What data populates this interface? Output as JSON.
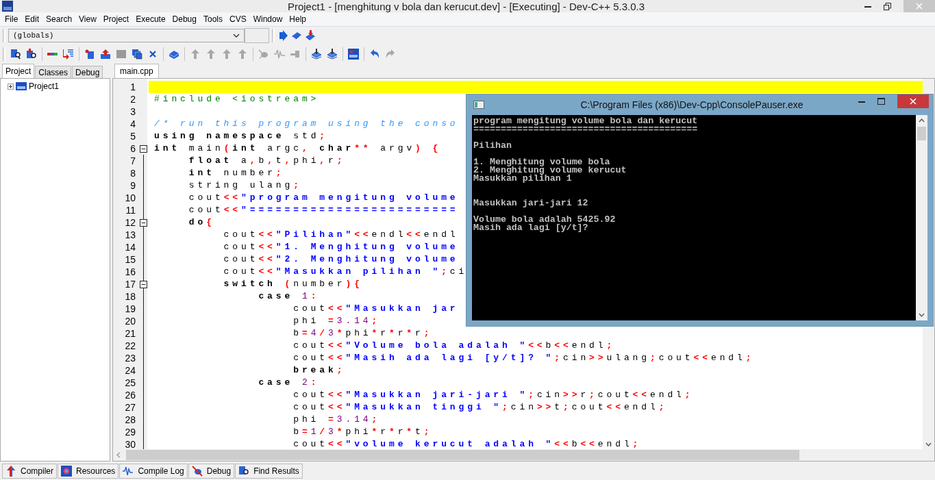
{
  "window": {
    "title": "Project1 - [menghitung v bola dan kerucut.dev] - [Executing] - Dev-C++ 5.3.0.3"
  },
  "menu": [
    "File",
    "Edit",
    "Search",
    "View",
    "Project",
    "Execute",
    "Debug",
    "Tools",
    "CVS",
    "Window",
    "Help"
  ],
  "toolbar": {
    "scope_dropdown": "(globals)"
  },
  "left_panel": {
    "tabs": [
      {
        "label": "Project",
        "selected": true
      },
      {
        "label": "Classes",
        "selected": false
      },
      {
        "label": "Debug",
        "selected": false
      }
    ],
    "tree": [
      {
        "label": "Project1",
        "expanded": false
      }
    ]
  },
  "editor": {
    "tabs": [
      {
        "label": "main.cpp",
        "selected": true
      }
    ],
    "lines": [
      {
        "number": "1",
        "fold": false,
        "current": true
      },
      {
        "number": "2",
        "fold": false,
        "current": false,
        "tokens": [
          {
            "kind": "pre",
            "text": "#include <iostream>"
          }
        ]
      },
      {
        "number": "3",
        "fold": false,
        "current": false
      },
      {
        "number": "4",
        "fold": false,
        "current": false,
        "tokens": [
          {
            "kind": "cmt",
            "text": "/* run this program using the conso"
          }
        ]
      },
      {
        "number": "5",
        "fold": false,
        "current": false,
        "tokens": [
          {
            "kind": "kw",
            "text": "using namespace"
          },
          {
            "kind": "id",
            "text": " std"
          },
          {
            "kind": "op",
            "text": ";"
          }
        ]
      },
      {
        "number": "6",
        "fold": true,
        "current": false,
        "tokens": [
          {
            "kind": "kw",
            "text": "int"
          },
          {
            "kind": "id",
            "text": " main"
          },
          {
            "kind": "op",
            "text": "("
          },
          {
            "kind": "kw",
            "text": "int"
          },
          {
            "kind": "id",
            "text": " argc"
          },
          {
            "kind": "op",
            "text": ","
          },
          {
            "kind": "kw",
            "text": " char"
          },
          {
            "kind": "op",
            "text": "**"
          },
          {
            "kind": "id",
            "text": " argv"
          },
          {
            "kind": "op",
            "text": ") {"
          }
        ]
      },
      {
        "number": "7",
        "fold": false,
        "current": false,
        "tokens": [
          {
            "kind": "kw",
            "text": "    float"
          },
          {
            "kind": "id",
            "text": " a"
          },
          {
            "kind": "op",
            "text": ","
          },
          {
            "kind": "id",
            "text": "b"
          },
          {
            "kind": "op",
            "text": ","
          },
          {
            "kind": "id",
            "text": "t"
          },
          {
            "kind": "op",
            "text": ","
          },
          {
            "kind": "id",
            "text": "phi"
          },
          {
            "kind": "op",
            "text": ","
          },
          {
            "kind": "id",
            "text": "r"
          },
          {
            "kind": "op",
            "text": ";"
          }
        ]
      },
      {
        "number": "8",
        "fold": false,
        "current": false,
        "tokens": [
          {
            "kind": "kw",
            "text": "    int"
          },
          {
            "kind": "id",
            "text": " number"
          },
          {
            "kind": "op",
            "text": ";"
          }
        ]
      },
      {
        "number": "9",
        "fold": false,
        "current": false,
        "tokens": [
          {
            "kind": "id",
            "text": "    string ulang"
          },
          {
            "kind": "op",
            "text": ";"
          }
        ]
      },
      {
        "number": "10",
        "fold": false,
        "current": false,
        "tokens": [
          {
            "kind": "id",
            "text": "    cout"
          },
          {
            "kind": "op",
            "text": "<<"
          },
          {
            "kind": "str",
            "text": "\"program mengitung volume"
          }
        ]
      },
      {
        "number": "11",
        "fold": false,
        "current": false,
        "tokens": [
          {
            "kind": "id",
            "text": "    cout"
          },
          {
            "kind": "op",
            "text": "<<"
          },
          {
            "kind": "str",
            "text": "\"========================"
          }
        ]
      },
      {
        "number": "12",
        "fold": true,
        "current": false,
        "tokens": [
          {
            "kind": "kw",
            "text": "    do"
          },
          {
            "kind": "op",
            "text": "{"
          }
        ]
      },
      {
        "number": "13",
        "fold": false,
        "current": false,
        "tokens": [
          {
            "kind": "id",
            "text": "        cout"
          },
          {
            "kind": "op",
            "text": "<<"
          },
          {
            "kind": "str",
            "text": "\"Pilihan\""
          },
          {
            "kind": "op",
            "text": "<<"
          },
          {
            "kind": "id",
            "text": "endl"
          },
          {
            "kind": "op",
            "text": "<<"
          },
          {
            "kind": "id",
            "text": "endl"
          }
        ]
      },
      {
        "number": "14",
        "fold": false,
        "current": false,
        "tokens": [
          {
            "kind": "id",
            "text": "        cout"
          },
          {
            "kind": "op",
            "text": "<<"
          },
          {
            "kind": "str",
            "text": "\"1. Menghitung volume"
          }
        ]
      },
      {
        "number": "15",
        "fold": false,
        "current": false,
        "tokens": [
          {
            "kind": "id",
            "text": "        cout"
          },
          {
            "kind": "op",
            "text": "<<"
          },
          {
            "kind": "str",
            "text": "\"2. Menghitung volume"
          }
        ]
      },
      {
        "number": "16",
        "fold": false,
        "current": false,
        "tokens": [
          {
            "kind": "id",
            "text": "        cout"
          },
          {
            "kind": "op",
            "text": "<<"
          },
          {
            "kind": "str",
            "text": "\"Masukkan pilihan \""
          },
          {
            "kind": "op",
            "text": ";"
          },
          {
            "kind": "id",
            "text": "ci"
          }
        ]
      },
      {
        "number": "17",
        "fold": true,
        "current": false,
        "tokens": [
          {
            "kind": "kw",
            "text": "        switch"
          },
          {
            "kind": "op",
            "text": " ("
          },
          {
            "kind": "id",
            "text": "number"
          },
          {
            "kind": "op",
            "text": "){"
          }
        ]
      },
      {
        "number": "18",
        "fold": false,
        "current": false,
        "tokens": [
          {
            "kind": "kw",
            "text": "            case"
          },
          {
            "kind": "num",
            "text": " 1"
          },
          {
            "kind": "op",
            "text": ":"
          }
        ]
      },
      {
        "number": "19",
        "fold": false,
        "current": false,
        "tokens": [
          {
            "kind": "id",
            "text": "                cout"
          },
          {
            "kind": "op",
            "text": "<<"
          },
          {
            "kind": "str",
            "text": "\"Masukkan jar"
          }
        ]
      },
      {
        "number": "20",
        "fold": false,
        "current": false,
        "tokens": [
          {
            "kind": "id",
            "text": "                phi "
          },
          {
            "kind": "op",
            "text": "="
          },
          {
            "kind": "num",
            "text": "3.14"
          },
          {
            "kind": "op",
            "text": ";"
          }
        ]
      },
      {
        "number": "21",
        "fold": false,
        "current": false,
        "tokens": [
          {
            "kind": "id",
            "text": "                b"
          },
          {
            "kind": "op",
            "text": "="
          },
          {
            "kind": "num",
            "text": "4"
          },
          {
            "kind": "op",
            "text": "/"
          },
          {
            "kind": "num",
            "text": "3"
          },
          {
            "kind": "op",
            "text": "*"
          },
          {
            "kind": "id",
            "text": "phi"
          },
          {
            "kind": "op",
            "text": "*"
          },
          {
            "kind": "id",
            "text": "r"
          },
          {
            "kind": "op",
            "text": "*"
          },
          {
            "kind": "id",
            "text": "r"
          },
          {
            "kind": "op",
            "text": "*"
          },
          {
            "kind": "id",
            "text": "r"
          },
          {
            "kind": "op",
            "text": ";"
          }
        ]
      },
      {
        "number": "22",
        "fold": false,
        "current": false,
        "tokens": [
          {
            "kind": "id",
            "text": "                cout"
          },
          {
            "kind": "op",
            "text": "<<"
          },
          {
            "kind": "str",
            "text": "\"Volume bola adalah \""
          },
          {
            "kind": "op",
            "text": "<<"
          },
          {
            "kind": "id",
            "text": "b"
          },
          {
            "kind": "op",
            "text": "<<"
          },
          {
            "kind": "id",
            "text": "endl"
          },
          {
            "kind": "op",
            "text": ";"
          }
        ]
      },
      {
        "number": "23",
        "fold": false,
        "current": false,
        "tokens": [
          {
            "kind": "id",
            "text": "                cout"
          },
          {
            "kind": "op",
            "text": "<<"
          },
          {
            "kind": "str",
            "text": "\"Masih ada lagi [y/t]? \""
          },
          {
            "kind": "op",
            "text": ";"
          },
          {
            "kind": "id",
            "text": "cin"
          },
          {
            "kind": "op",
            "text": ">>"
          },
          {
            "kind": "id",
            "text": "ulang"
          },
          {
            "kind": "op",
            "text": ";"
          },
          {
            "kind": "id",
            "text": "cout"
          },
          {
            "kind": "op",
            "text": "<<"
          },
          {
            "kind": "id",
            "text": "endl"
          },
          {
            "kind": "op",
            "text": ";"
          }
        ]
      },
      {
        "number": "24",
        "fold": false,
        "current": false,
        "tokens": [
          {
            "kind": "kw",
            "text": "                break"
          },
          {
            "kind": "op",
            "text": ";"
          }
        ]
      },
      {
        "number": "25",
        "fold": false,
        "current": false,
        "tokens": [
          {
            "kind": "kw",
            "text": "            case"
          },
          {
            "kind": "num",
            "text": " 2"
          },
          {
            "kind": "op",
            "text": ":"
          }
        ]
      },
      {
        "number": "26",
        "fold": false,
        "current": false,
        "tokens": [
          {
            "kind": "id",
            "text": "                cout"
          },
          {
            "kind": "op",
            "text": "<<"
          },
          {
            "kind": "str",
            "text": "\"Masukkan jari-jari \""
          },
          {
            "kind": "op",
            "text": ";"
          },
          {
            "kind": "id",
            "text": "cin"
          },
          {
            "kind": "op",
            "text": ">>"
          },
          {
            "kind": "id",
            "text": "r"
          },
          {
            "kind": "op",
            "text": ";"
          },
          {
            "kind": "id",
            "text": "cout"
          },
          {
            "kind": "op",
            "text": "<<"
          },
          {
            "kind": "id",
            "text": "endl"
          },
          {
            "kind": "op",
            "text": ";"
          }
        ]
      },
      {
        "number": "27",
        "fold": false,
        "current": false,
        "tokens": [
          {
            "kind": "id",
            "text": "                cout"
          },
          {
            "kind": "op",
            "text": "<<"
          },
          {
            "kind": "str",
            "text": "\"Masukkan tinggi \""
          },
          {
            "kind": "op",
            "text": ";"
          },
          {
            "kind": "id",
            "text": "cin"
          },
          {
            "kind": "op",
            "text": ">>"
          },
          {
            "kind": "id",
            "text": "t"
          },
          {
            "kind": "op",
            "text": ";"
          },
          {
            "kind": "id",
            "text": "cout"
          },
          {
            "kind": "op",
            "text": "<<"
          },
          {
            "kind": "id",
            "text": "endl"
          },
          {
            "kind": "op",
            "text": ";"
          }
        ]
      },
      {
        "number": "28",
        "fold": false,
        "current": false,
        "tokens": [
          {
            "kind": "id",
            "text": "                phi "
          },
          {
            "kind": "op",
            "text": "="
          },
          {
            "kind": "num",
            "text": "3.14"
          },
          {
            "kind": "op",
            "text": ";"
          }
        ]
      },
      {
        "number": "29",
        "fold": false,
        "current": false,
        "tokens": [
          {
            "kind": "id",
            "text": "                b"
          },
          {
            "kind": "op",
            "text": "="
          },
          {
            "kind": "num",
            "text": "1"
          },
          {
            "kind": "op",
            "text": "/"
          },
          {
            "kind": "num",
            "text": "3"
          },
          {
            "kind": "op",
            "text": "*"
          },
          {
            "kind": "id",
            "text": "phi"
          },
          {
            "kind": "op",
            "text": "*"
          },
          {
            "kind": "id",
            "text": "r"
          },
          {
            "kind": "op",
            "text": "*"
          },
          {
            "kind": "id",
            "text": "r"
          },
          {
            "kind": "op",
            "text": "*"
          },
          {
            "kind": "id",
            "text": "t"
          },
          {
            "kind": "op",
            "text": ";"
          }
        ]
      },
      {
        "number": "30",
        "fold": false,
        "current": false,
        "tokens": [
          {
            "kind": "id",
            "text": "                cout"
          },
          {
            "kind": "op",
            "text": "<<"
          },
          {
            "kind": "str",
            "text": "\"volume kerucut adalah \""
          },
          {
            "kind": "op",
            "text": "<<"
          },
          {
            "kind": "id",
            "text": "b"
          },
          {
            "kind": "op",
            "text": "<<"
          },
          {
            "kind": "id",
            "text": "endl"
          },
          {
            "kind": "op",
            "text": ";"
          }
        ]
      }
    ]
  },
  "console": {
    "title": "C:\\Program Files (x86)\\Dev-Cpp\\ConsolePauser.exe",
    "lines": [
      {
        "kind": "text",
        "text": "program mengitung volume bola dan kerucut"
      },
      {
        "kind": "text",
        "text": "========================================="
      },
      {
        "kind": "blank"
      },
      {
        "kind": "text",
        "text": "Pilihan"
      },
      {
        "kind": "blank"
      },
      {
        "kind": "text",
        "text": "1. Menghitung volume bola"
      },
      {
        "kind": "text",
        "text": "2. Menghitung volume kerucut"
      },
      {
        "kind": "text",
        "text": "Masukkan pilihan 1"
      },
      {
        "kind": "blank"
      },
      {
        "kind": "blank"
      },
      {
        "kind": "text",
        "text": "Masukkan jari-jari 12"
      },
      {
        "kind": "blank"
      },
      {
        "kind": "text",
        "text": "Volume bola adalah 5425.92"
      },
      {
        "kind": "text",
        "text": "Masih ada lagi [y/t]?"
      }
    ]
  },
  "bottom_tabs": [
    {
      "label": "Compiler"
    },
    {
      "label": "Resources"
    },
    {
      "label": "Compile Log"
    },
    {
      "label": "Debug"
    },
    {
      "label": "Find Results"
    }
  ]
}
